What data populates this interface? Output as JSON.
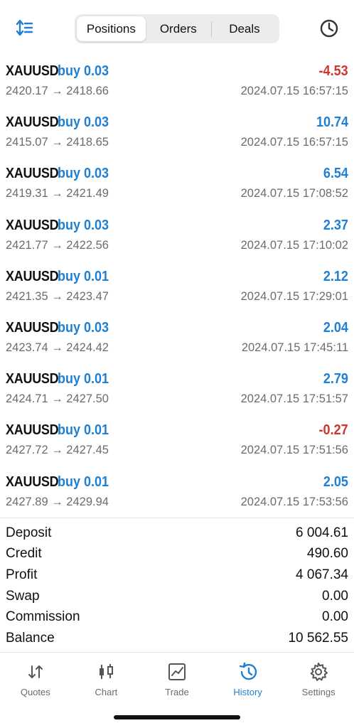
{
  "header": {
    "sort_icon": "sort-icon",
    "tabs": [
      {
        "label": "Positions",
        "active": true
      },
      {
        "label": "Orders",
        "active": false
      },
      {
        "label": "Deals",
        "active": false
      }
    ],
    "history_icon": "clock-icon"
  },
  "deals": [
    {
      "symbol": "XAUUSD",
      "side": "buy 0.03",
      "prices": "2420.17 → 2418.66",
      "profit": "-4.53",
      "time": "2024.07.15 16:57:15"
    },
    {
      "symbol": "XAUUSD",
      "side": "buy 0.03",
      "prices": "2415.07 → 2418.65",
      "profit": "10.74",
      "time": "2024.07.15 16:57:15"
    },
    {
      "symbol": "XAUUSD",
      "side": "buy 0.03",
      "prices": "2419.31 → 2421.49",
      "profit": "6.54",
      "time": "2024.07.15 17:08:52"
    },
    {
      "symbol": "XAUUSD",
      "side": "buy 0.03",
      "prices": "2421.77 → 2422.56",
      "profit": "2.37",
      "time": "2024.07.15 17:10:02"
    },
    {
      "symbol": "XAUUSD",
      "side": "buy 0.01",
      "prices": "2421.35 → 2423.47",
      "profit": "2.12",
      "time": "2024.07.15 17:29:01"
    },
    {
      "symbol": "XAUUSD",
      "side": "buy 0.03",
      "prices": "2423.74 → 2424.42",
      "profit": "2.04",
      "time": "2024.07.15 17:45:11"
    },
    {
      "symbol": "XAUUSD",
      "side": "buy 0.01",
      "prices": "2424.71 → 2427.50",
      "profit": "2.79",
      "time": "2024.07.15 17:51:57"
    },
    {
      "symbol": "XAUUSD",
      "side": "buy 0.01",
      "prices": "2427.72 → 2427.45",
      "profit": "-0.27",
      "time": "2024.07.15 17:51:56"
    },
    {
      "symbol": "XAUUSD",
      "side": "buy 0.01",
      "prices": "2427.89 → 2429.94",
      "profit": "2.05",
      "time": "2024.07.15 17:53:56"
    }
  ],
  "summary": [
    {
      "label": "Deposit",
      "value": "6 004.61"
    },
    {
      "label": "Credit",
      "value": "490.60"
    },
    {
      "label": "Profit",
      "value": "4 067.34"
    },
    {
      "label": "Swap",
      "value": "0.00"
    },
    {
      "label": "Commission",
      "value": "0.00"
    },
    {
      "label": "Balance",
      "value": "10 562.55"
    }
  ],
  "tabbar": [
    {
      "label": "Quotes",
      "icon": "quotes-icon",
      "active": false
    },
    {
      "label": "Chart",
      "icon": "candlestick-icon",
      "active": false
    },
    {
      "label": "Trade",
      "icon": "trade-chart-icon",
      "active": false
    },
    {
      "label": "History",
      "icon": "history-icon",
      "active": true
    },
    {
      "label": "Settings",
      "icon": "gear-icon",
      "active": false
    }
  ],
  "colors": {
    "accent": "#1f7fd2",
    "loss": "#d0342c",
    "muted": "#6b6b70"
  }
}
